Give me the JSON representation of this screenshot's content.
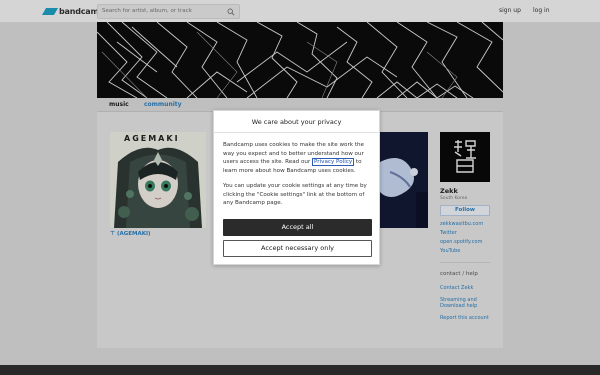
{
  "topbar": {
    "logo_text": "bandcamp",
    "search_placeholder": "Search for artist, album, or track",
    "sign_up": "sign up",
    "log_in": "log in"
  },
  "nav": {
    "music": "music",
    "community": "community"
  },
  "album": {
    "title": "(AGEMAKI)",
    "art_text": "AGEMAKI"
  },
  "sidebar": {
    "band_name": "Zekk",
    "location": "South Korea",
    "follow": "Follow",
    "links": [
      "zekkwasitbu.com",
      "Twitter",
      "open.spotify.com",
      "YouTube"
    ],
    "contact_heading": "contact / help",
    "contact_links": [
      "Contact Zekk",
      "Streaming and Download help",
      "Report this account"
    ]
  },
  "cookie_dialog": {
    "title": "We care about your privacy",
    "para1_before": "Bandcamp uses cookies to make the site work the way you expect and to better understand how our users access the site. Read our ",
    "privacy_link": "Privacy Policy",
    "para1_after": " to learn more about how Bandcamp uses cookies.",
    "para2": "You can update your cookie settings at any time by clicking the \"Cookie settings\" link at the bottom of any Bandcamp page.",
    "accept_all": "Accept all",
    "accept_necessary": "Accept necessary only"
  },
  "colors": {
    "link": "#2a7fbf",
    "logo": "#1da0c3",
    "accept_bg": "#2b2b2b"
  }
}
